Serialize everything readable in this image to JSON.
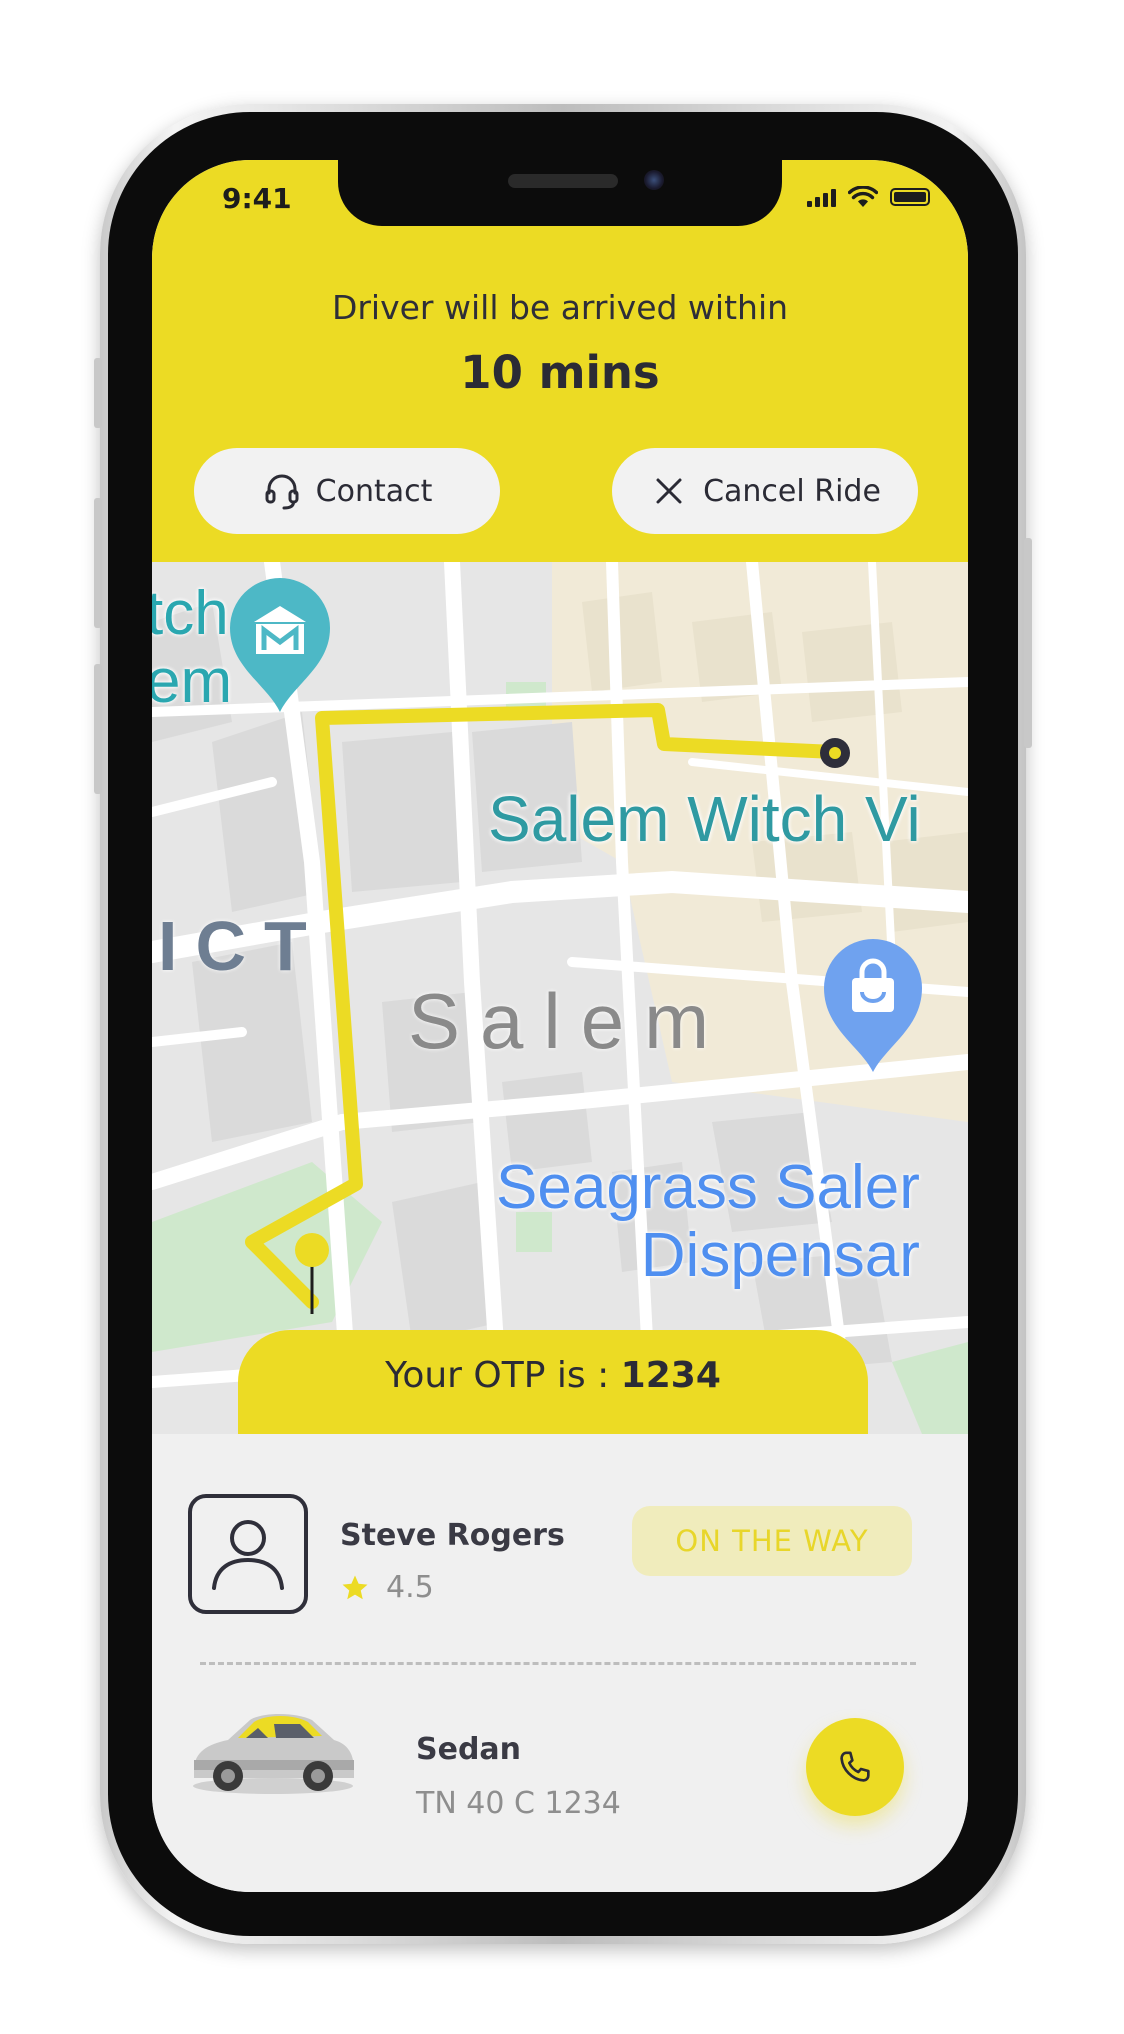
{
  "status_bar": {
    "time": "9:41"
  },
  "header": {
    "arrival_text": "Driver will be arrived within",
    "arrival_time": "10 mins",
    "contact_label": "Contact",
    "cancel_label": "Cancel Ride",
    "accent_color": "#ecdb24"
  },
  "map": {
    "labels": {
      "witch_left_1": "tch",
      "witch_left_2": "em",
      "salem_witch": "Salem Witch Vi",
      "district": "ICT",
      "salem": "Salem",
      "seagrass_1": "Seagrass Saler",
      "seagrass_2": "Dispensar"
    },
    "icons": [
      "museum-pin-icon",
      "shopping-pin-icon",
      "destination-marker-icon",
      "origin-pin-icon"
    ]
  },
  "otp": {
    "prefix": "Your OTP is : ",
    "code": "1234"
  },
  "driver": {
    "name": "Steve Rogers",
    "rating": "4.5",
    "status": "ON THE WAY"
  },
  "vehicle": {
    "type": "Sedan",
    "plate": "TN 40 C 1234"
  }
}
